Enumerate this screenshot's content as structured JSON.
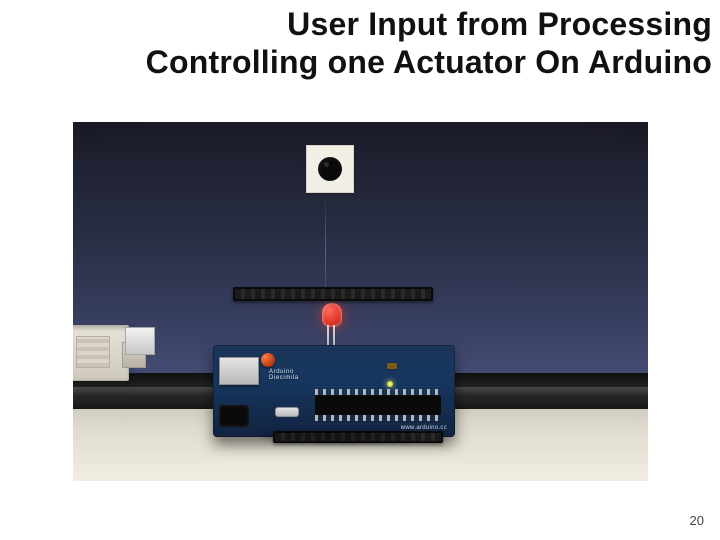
{
  "title_line1": "User Input from Processing",
  "title_line2": "Controlling one Actuator On Arduino",
  "board_silk_name": "Arduino",
  "board_silk_model": "Diecimila",
  "board_silk_url": "www.arduino.cc",
  "page_number": "20"
}
